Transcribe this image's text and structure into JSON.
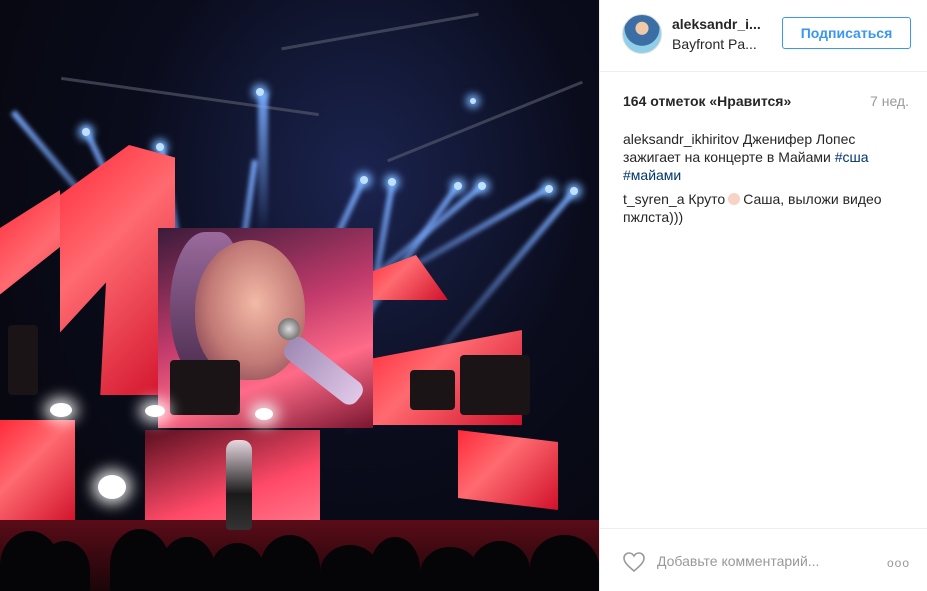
{
  "post": {
    "username": "aleksandr_i...",
    "location": "Bayfront Pa...",
    "follow_label": "Подписаться",
    "likes_text": "164 отметок «Нравится»",
    "age_text": "7 нед.",
    "comments": [
      {
        "user": "aleksandr_ikhiritov",
        "text": "Дженифер Лопес зажигает на концерте в Майами ",
        "tags": [
          "#сша",
          "#майами"
        ]
      },
      {
        "user": "t_syren_a",
        "text_before": "Круто",
        "text_after": "Саша, выложи видео пжлста)))"
      }
    ],
    "comment_placeholder": "Добавьте комментарий...",
    "more_icon_text": "ooo"
  },
  "icons": {
    "heart": "heart-icon",
    "more": "more-options-icon",
    "emoji": "emoji-icon"
  },
  "colors": {
    "accent": "#3897f0",
    "hashtag": "#003569",
    "muted": "#999999"
  }
}
